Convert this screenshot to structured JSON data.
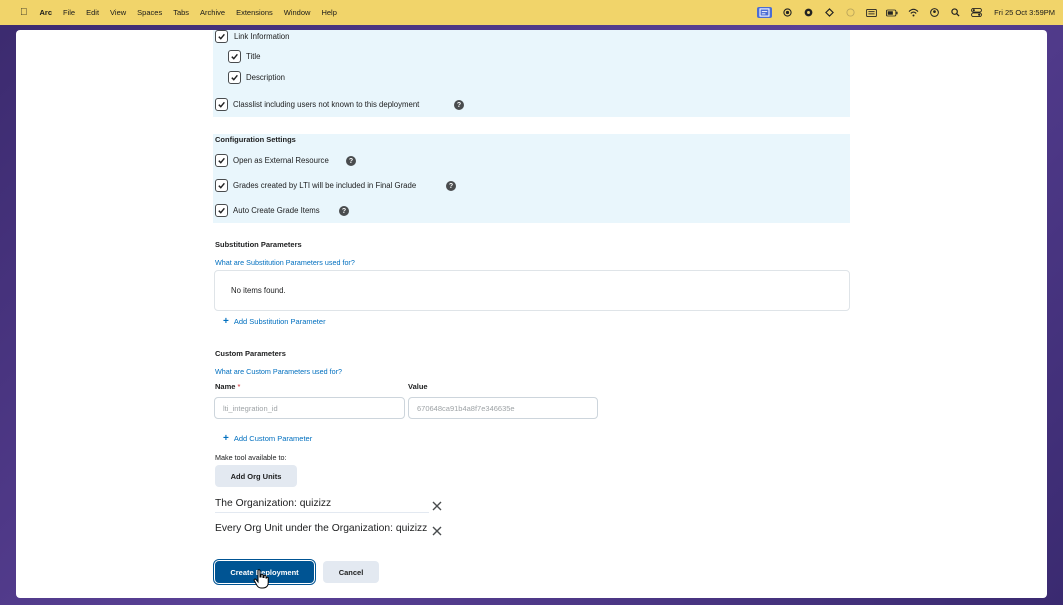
{
  "menubar": {
    "app": "Arc",
    "items": [
      "File",
      "Edit",
      "View",
      "Spaces",
      "Tabs",
      "Archive",
      "Extensions",
      "Window",
      "Help"
    ],
    "clock": "Fri 25 Oct  3:59PM"
  },
  "link_info": {
    "label": "Link Information",
    "title_label": "Title",
    "description_label": "Description",
    "classlist_label": "Classlist including users not known to this deployment"
  },
  "config": {
    "heading": "Configuration Settings",
    "external_label": "Open as External Resource",
    "grades_label": "Grades created by LTI will be included in Final Grade",
    "auto_grade_label": "Auto Create Grade Items"
  },
  "substitution": {
    "heading": "Substitution Parameters",
    "help_link": "What are Substitution Parameters used for?",
    "empty_text": "No items found.",
    "add_label": "Add Substitution Parameter"
  },
  "custom": {
    "heading": "Custom Parameters",
    "help_link": "What are Custom Parameters used for?",
    "name_label": "Name",
    "required_mark": "*",
    "value_label": "Value",
    "name_value": "lti_integration_id",
    "value_value": "670648ca91b4a8f7e346635e",
    "add_label": "Add Custom Parameter"
  },
  "availability": {
    "label": "Make tool available to:",
    "add_org_units": "Add Org Units",
    "org_entry_1": "The Organization: quizizz",
    "org_entry_2": "Every Org Unit under the Organization: quizizz"
  },
  "actions": {
    "create": "Create Deployment",
    "cancel": "Cancel"
  }
}
